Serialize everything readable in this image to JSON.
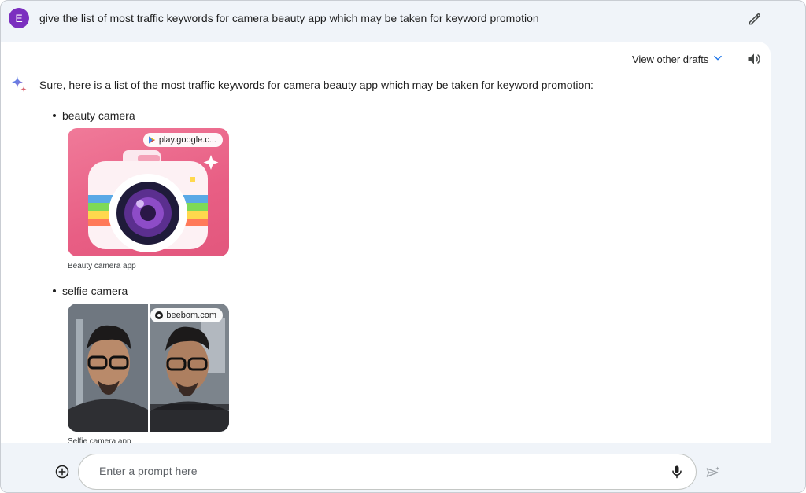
{
  "user": {
    "avatar_letter": "E"
  },
  "prompt": {
    "text": "give the list of most traffic keywords for camera beauty app which may be taken for keyword promotion"
  },
  "response": {
    "view_drafts_label": "View other drafts",
    "intro": "Sure, here is a list of the most traffic keywords for camera beauty app which may be taken for keyword promotion:",
    "items": [
      {
        "keyword": "beauty camera",
        "source": "play.google.c...",
        "caption": "Beauty camera app"
      },
      {
        "keyword": "selfie camera",
        "source": "beebom.com",
        "caption": "Selfie camera app"
      }
    ]
  },
  "input": {
    "placeholder": "Enter a prompt here"
  },
  "colors": {
    "avatar": "#7b2fbf",
    "accent": "#1a73e8",
    "background": "#f0f4f9"
  }
}
